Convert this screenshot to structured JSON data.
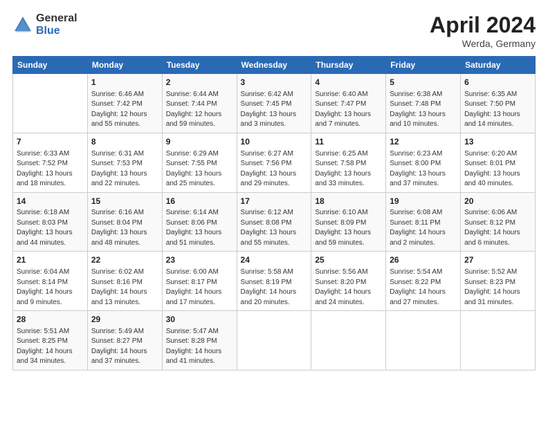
{
  "header": {
    "logo_general": "General",
    "logo_blue": "Blue",
    "title": "April 2024",
    "location": "Werda, Germany"
  },
  "days_of_week": [
    "Sunday",
    "Monday",
    "Tuesday",
    "Wednesday",
    "Thursday",
    "Friday",
    "Saturday"
  ],
  "weeks": [
    [
      {
        "day": "",
        "info": ""
      },
      {
        "day": "1",
        "info": "Sunrise: 6:46 AM\nSunset: 7:42 PM\nDaylight: 12 hours\nand 55 minutes."
      },
      {
        "day": "2",
        "info": "Sunrise: 6:44 AM\nSunset: 7:44 PM\nDaylight: 12 hours\nand 59 minutes."
      },
      {
        "day": "3",
        "info": "Sunrise: 6:42 AM\nSunset: 7:45 PM\nDaylight: 13 hours\nand 3 minutes."
      },
      {
        "day": "4",
        "info": "Sunrise: 6:40 AM\nSunset: 7:47 PM\nDaylight: 13 hours\nand 7 minutes."
      },
      {
        "day": "5",
        "info": "Sunrise: 6:38 AM\nSunset: 7:48 PM\nDaylight: 13 hours\nand 10 minutes."
      },
      {
        "day": "6",
        "info": "Sunrise: 6:35 AM\nSunset: 7:50 PM\nDaylight: 13 hours\nand 14 minutes."
      }
    ],
    [
      {
        "day": "7",
        "info": "Sunrise: 6:33 AM\nSunset: 7:52 PM\nDaylight: 13 hours\nand 18 minutes."
      },
      {
        "day": "8",
        "info": "Sunrise: 6:31 AM\nSunset: 7:53 PM\nDaylight: 13 hours\nand 22 minutes."
      },
      {
        "day": "9",
        "info": "Sunrise: 6:29 AM\nSunset: 7:55 PM\nDaylight: 13 hours\nand 25 minutes."
      },
      {
        "day": "10",
        "info": "Sunrise: 6:27 AM\nSunset: 7:56 PM\nDaylight: 13 hours\nand 29 minutes."
      },
      {
        "day": "11",
        "info": "Sunrise: 6:25 AM\nSunset: 7:58 PM\nDaylight: 13 hours\nand 33 minutes."
      },
      {
        "day": "12",
        "info": "Sunrise: 6:23 AM\nSunset: 8:00 PM\nDaylight: 13 hours\nand 37 minutes."
      },
      {
        "day": "13",
        "info": "Sunrise: 6:20 AM\nSunset: 8:01 PM\nDaylight: 13 hours\nand 40 minutes."
      }
    ],
    [
      {
        "day": "14",
        "info": "Sunrise: 6:18 AM\nSunset: 8:03 PM\nDaylight: 13 hours\nand 44 minutes."
      },
      {
        "day": "15",
        "info": "Sunrise: 6:16 AM\nSunset: 8:04 PM\nDaylight: 13 hours\nand 48 minutes."
      },
      {
        "day": "16",
        "info": "Sunrise: 6:14 AM\nSunset: 8:06 PM\nDaylight: 13 hours\nand 51 minutes."
      },
      {
        "day": "17",
        "info": "Sunrise: 6:12 AM\nSunset: 8:08 PM\nDaylight: 13 hours\nand 55 minutes."
      },
      {
        "day": "18",
        "info": "Sunrise: 6:10 AM\nSunset: 8:09 PM\nDaylight: 13 hours\nand 59 minutes."
      },
      {
        "day": "19",
        "info": "Sunrise: 6:08 AM\nSunset: 8:11 PM\nDaylight: 14 hours\nand 2 minutes."
      },
      {
        "day": "20",
        "info": "Sunrise: 6:06 AM\nSunset: 8:12 PM\nDaylight: 14 hours\nand 6 minutes."
      }
    ],
    [
      {
        "day": "21",
        "info": "Sunrise: 6:04 AM\nSunset: 8:14 PM\nDaylight: 14 hours\nand 9 minutes."
      },
      {
        "day": "22",
        "info": "Sunrise: 6:02 AM\nSunset: 8:16 PM\nDaylight: 14 hours\nand 13 minutes."
      },
      {
        "day": "23",
        "info": "Sunrise: 6:00 AM\nSunset: 8:17 PM\nDaylight: 14 hours\nand 17 minutes."
      },
      {
        "day": "24",
        "info": "Sunrise: 5:58 AM\nSunset: 8:19 PM\nDaylight: 14 hours\nand 20 minutes."
      },
      {
        "day": "25",
        "info": "Sunrise: 5:56 AM\nSunset: 8:20 PM\nDaylight: 14 hours\nand 24 minutes."
      },
      {
        "day": "26",
        "info": "Sunrise: 5:54 AM\nSunset: 8:22 PM\nDaylight: 14 hours\nand 27 minutes."
      },
      {
        "day": "27",
        "info": "Sunrise: 5:52 AM\nSunset: 8:23 PM\nDaylight: 14 hours\nand 31 minutes."
      }
    ],
    [
      {
        "day": "28",
        "info": "Sunrise: 5:51 AM\nSunset: 8:25 PM\nDaylight: 14 hours\nand 34 minutes."
      },
      {
        "day": "29",
        "info": "Sunrise: 5:49 AM\nSunset: 8:27 PM\nDaylight: 14 hours\nand 37 minutes."
      },
      {
        "day": "30",
        "info": "Sunrise: 5:47 AM\nSunset: 8:28 PM\nDaylight: 14 hours\nand 41 minutes."
      },
      {
        "day": "",
        "info": ""
      },
      {
        "day": "",
        "info": ""
      },
      {
        "day": "",
        "info": ""
      },
      {
        "day": "",
        "info": ""
      }
    ]
  ]
}
